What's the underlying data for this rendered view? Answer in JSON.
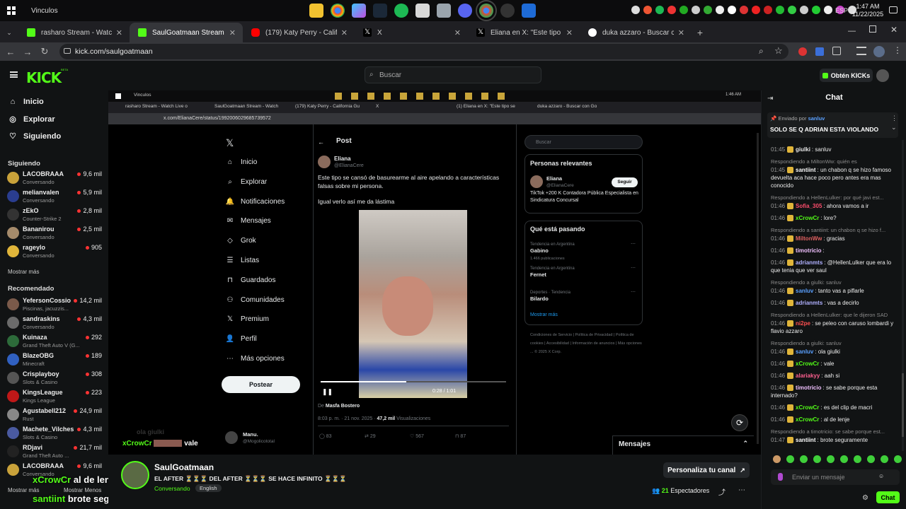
{
  "taskbar": {
    "title": "Vinculos",
    "lang": "ESP",
    "time": "1:47 AM",
    "date": "11/22/2025"
  },
  "tabs": [
    {
      "title": "rasharo Stream - Watch Live on Kick",
      "color": "#53fc18"
    },
    {
      "title": "SaulGoatmaan Stream - Watch Live on Kick",
      "color": "#53fc18",
      "active": true
    },
    {
      "title": "(179) Katy Perry - California Gurls",
      "color": "#ff0000"
    },
    {
      "title": "X",
      "color": "#ffffff"
    },
    {
      "title": "Eliana en X: \"Este tipo se cansó de",
      "color": "#ffffff"
    },
    {
      "title": "duka azzaro - Buscar con Google",
      "color": "#4285f4"
    }
  ],
  "url": "kick.com/saulgoatmaan",
  "header": {
    "logo": "KICK",
    "search_placeholder": "Buscar",
    "get_kicks": "Obtén KICKs"
  },
  "sidebar": {
    "nav": [
      "Inicio",
      "Explorar",
      "Siguiendo"
    ],
    "following_title": "Siguiendo",
    "following": [
      {
        "name": "LACOBRAAA",
        "game": "Conversando",
        "viewers": "9,6 mil",
        "color": "#c9a23a"
      },
      {
        "name": "melianvalen",
        "game": "Conversando",
        "viewers": "5,9 mil",
        "color": "#2a3d8f"
      },
      {
        "name": "zEkO",
        "game": "Counter-Strike 2",
        "viewers": "2,8 mil",
        "color": "#333"
      },
      {
        "name": "Bananirou",
        "game": "Conversando",
        "viewers": "2,5 mil",
        "color": "#a58b6b"
      },
      {
        "name": "rageylo",
        "game": "Conversando",
        "viewers": "905",
        "color": "#e0b53a"
      }
    ],
    "show_more": "Mostrar más",
    "recommended_title": "Recomendado",
    "recommended": [
      {
        "name": "YefersonCossio",
        "game": "Piscinas, jacuzzis...",
        "viewers": "14,2 mil",
        "color": "#7a5a4a"
      },
      {
        "name": "sandraskins",
        "game": "Conversando",
        "viewers": "4,3 mil",
        "color": "#6b6b6b"
      },
      {
        "name": "Kuinaza",
        "game": "Grand Theft Auto V (G...",
        "viewers": "292",
        "color": "#2d6b3a"
      },
      {
        "name": "BlazeOBG",
        "game": "Minecraft",
        "viewers": "189",
        "color": "#3060c0"
      },
      {
        "name": "Crisplayboy",
        "game": "Slots & Casino",
        "viewers": "308",
        "color": "#555"
      },
      {
        "name": "KingsLeague",
        "game": "Kings League",
        "viewers": "223",
        "color": "#c01818"
      },
      {
        "name": "Agustabell212",
        "game": "Rust",
        "viewers": "24,9 mil",
        "color": "#888"
      },
      {
        "name": "Machete_Vilches",
        "game": "Slots & Casino",
        "viewers": "4,3 mil",
        "color": "#4a5aa0"
      },
      {
        "name": "RDjavi",
        "game": "Grand Theft Auto ...",
        "viewers": "21,7 mil",
        "color": "#222"
      },
      {
        "name": "LACOBRAAA",
        "game": "Conversando",
        "viewers": "9,6 mil",
        "color": "#c9a23a"
      }
    ],
    "show_more2": "Mostrar más",
    "show_less": "Mostrar Menos"
  },
  "stream": {
    "inner_title": "Vinculos",
    "inner_tabs": [
      "rasharo Stream - Watch Live o",
      "SaulGoatmaan Stream - Watch",
      "(179) Katy Perry - California Gu",
      "X",
      "(1) Eliana en X: \"Este tipo se",
      "duka azzaro - Buscar con Go"
    ],
    "inner_url": "x.com/ElianaCere/status/1992006029685739572",
    "xnav": [
      "Inicio",
      "Explorar",
      "Notificaciones",
      "Mensajes",
      "Grok",
      "Listas",
      "Guardados",
      "Comunidades",
      "Premium",
      "Perfil",
      "Más opciones"
    ],
    "post_button": "Postear",
    "post_header": "Post",
    "author": "Eliana",
    "handle": "@ElianaCere",
    "post_text": "Este tipo se cansó de basurearme al aire apelando a características falsas sobre mi persona.",
    "post_text2": "Igual verlo así me da lástima",
    "video_time": "0:28 / 1:01",
    "video_credit_pre": "De",
    "video_credit": "Masfa Bostero",
    "meta_pre": "8:03 p. m. · 21 nov. 2025 · ",
    "meta_views": "47,2 mil",
    "meta_post": " Visualizaciones",
    "stats": [
      "83",
      "29",
      "567",
      "87"
    ],
    "search": "Buscar",
    "relevant_title": "Personas relevantes",
    "relevant_name": "Eliana",
    "relevant_handle": "@ElianaCere",
    "follow": "Seguir",
    "relevant_bio": "TikTok +200 K Contadora Pública Especialista en Sindicatura Concursal",
    "trending_title": "Qué está pasando",
    "trends": [
      {
        "ctx": "Tendencia en Argentina",
        "name": "Gabino",
        "count": "1.466 publicaciones"
      },
      {
        "ctx": "Tendencia en Argentina",
        "name": "Fernet",
        "count": ""
      },
      {
        "ctx": "Deportes · Tendencia",
        "name": "Bilardo",
        "count": ""
      }
    ],
    "show_more": "Mostrar más",
    "footer": "Condiciones de Servicio | Política de Privacidad | Política de cookies | Accesibilidad | Información de anuncios | Más opciones ... © 2025 X Corp.",
    "reply_name": "Manu.",
    "reply_handle": "@Mogolicototal",
    "messages": "Mensajes",
    "overlay_user": "xCrowCr",
    "overlay_msg": "vale",
    "overlay_faded": "ola giulki"
  },
  "overlay": {
    "line1_user": "xCrowCr",
    "line1_msg": "al de lenje",
    "line2_user": "santiint",
    "line2_msg": "brote seguramente"
  },
  "info": {
    "channel": "SaulGoatmaan",
    "title": "EL AFTER ⏳⏳⏳ DEL AFTER ⏳⏳⏳ SE HACE INFINITO ⏳⏳⏳",
    "category": "Conversando",
    "tag": "English",
    "customize": "Personaliza tu canal",
    "viewers": "21",
    "viewers_label": "Espectadores"
  },
  "chat": {
    "title": "Chat",
    "pinned_by": "Enviado por",
    "pinned_user": "sanluv",
    "pinned_msg": "SOLO SE Q ADRIAN ESTA VIOLANDO",
    "input_placeholder": "Enviar un mensaje",
    "send": "Chat",
    "messages": [
      {
        "time": "01:45",
        "user": "giulki",
        "color": "#e8e8e8",
        "msg": "sanluv"
      },
      {
        "reply": "Respondiendo a MiltonWw: quién es"
      },
      {
        "time": "01:45",
        "user": "santiint",
        "color": "#ffffff",
        "msg": "un chabon q se hizo famoso devuelta aca hace poco pero antes era mas conocido"
      },
      {
        "reply": "Respondiendo a HellenLulker: por qué javi est..."
      },
      {
        "time": "01:46",
        "user": "Sofia_305",
        "color": "#ff4d6d",
        "msg": "ahora vamos a ir"
      },
      {
        "time": "01:46",
        "user": "xCrowCr",
        "color": "#53fc18",
        "msg": "lore?"
      },
      {
        "reply": "Respondiendo a santiint: un chabon q se hizo f..."
      },
      {
        "time": "01:46",
        "user": "MiltonWw",
        "color": "#e06060",
        "msg": "gracias"
      },
      {
        "time": "01:46",
        "user": "timotricio",
        "color": "#f0c0ff",
        "msg": ""
      },
      {
        "time": "01:46",
        "user": "adrianmts",
        "color": "#b0b0ff",
        "msg": "@HellenLulker que era lo que tenia que ver saul"
      },
      {
        "reply": "Respondiendo a giulki: sanluv"
      },
      {
        "time": "01:46",
        "user": "sanluv",
        "color": "#5aa0ff",
        "msg": "tanto vas a piflarle"
      },
      {
        "time": "01:46",
        "user": "adrianmts",
        "color": "#b0b0ff",
        "msg": "vas a decirlo"
      },
      {
        "reply": "Respondiendo a HellenLulker: que le dijeron SAD"
      },
      {
        "time": "01:46",
        "user": "ni2pe",
        "color": "#ff5050",
        "msg": "se peleo con caruso lombardi y flavio azzaro"
      },
      {
        "reply": "Respondiendo a giulki: sanluv"
      },
      {
        "time": "01:46",
        "user": "sanluv",
        "color": "#5aa0ff",
        "msg": "ola giulki"
      },
      {
        "time": "01:46",
        "user": "xCrowCr",
        "color": "#53fc18",
        "msg": "vale"
      },
      {
        "time": "01:46",
        "user": "alariakyy",
        "color": "#ff6090",
        "msg": "aah si"
      },
      {
        "time": "01:46",
        "user": "timotricio",
        "color": "#f0c0ff",
        "msg": "se sabe porque esta internado?"
      },
      {
        "time": "01:46",
        "user": "xCrowCr",
        "color": "#53fc18",
        "msg": "es del clip de macri"
      },
      {
        "time": "01:46",
        "user": "xCrowCr",
        "color": "#53fc18",
        "msg": "al de lenje"
      },
      {
        "reply": "Respondiendo a timotricio: se sabe porque est..."
      },
      {
        "time": "01:47",
        "user": "santiint",
        "color": "#ffffff",
        "msg": "brote seguramente"
      }
    ]
  },
  "colors": {
    "accent": "#53fc18",
    "bg": "#0b0e0f"
  }
}
